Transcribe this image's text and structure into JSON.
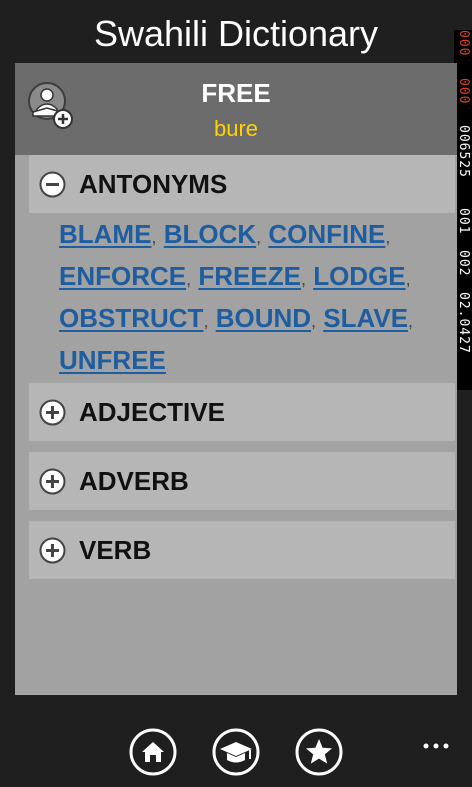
{
  "app": {
    "title": "Swahili Dictionary"
  },
  "debug_counters": [
    "000",
    "000",
    "006525",
    "001",
    "002",
    "02.0427"
  ],
  "entry": {
    "word": "FREE",
    "translation": "bure"
  },
  "sections": [
    {
      "label": "ANTONYMS",
      "expanded": true,
      "items": [
        "BLAME",
        "BLOCK",
        "CONFINE",
        "ENFORCE",
        "FREEZE",
        "LODGE",
        "OBSTRUCT",
        "BOUND",
        "SLAVE",
        "UNFREE"
      ]
    },
    {
      "label": "ADJECTIVE",
      "expanded": false
    },
    {
      "label": "ADVERB",
      "expanded": false
    },
    {
      "label": "VERB",
      "expanded": false
    }
  ],
  "separator": ",",
  "appbar": {
    "buttons": [
      "home-icon",
      "graduation-cap-icon",
      "star-icon"
    ],
    "more": "more-icon"
  },
  "colors": {
    "background": "#1f1f1f",
    "panel": "#a2a2a2",
    "header": "#6c6c6c",
    "section": "#b6b6b6",
    "link": "#1d5da0",
    "translation": "#ffd200"
  }
}
